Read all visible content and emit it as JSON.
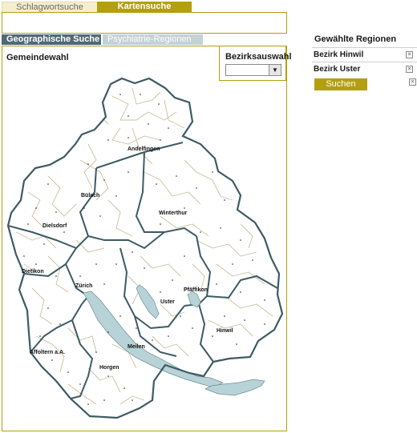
{
  "tabs_top": {
    "schlagwort": "Schlagwortsuche",
    "karten": "Kartensuche"
  },
  "tabs_sub": {
    "geo": "Geographische Suche",
    "psych": "Psychiatrie-Regionen"
  },
  "map": {
    "title": "Gemeindewahl",
    "districts": {
      "andelfingen": "Andelfingen",
      "buelach": "Bülach",
      "winterthur": "Winterthur",
      "dielsdorf": "Dielsdorf",
      "dietikon": "Dietikon",
      "zuerich": "Zürich",
      "pfaeffikon": "Pfäffikon",
      "uster": "Uster",
      "hinwil": "Hinwil",
      "affoltern": "Affoltern a.A.",
      "meilen": "Meilen",
      "horgen": "Horgen"
    },
    "colors": {
      "outline": "#3d5a63",
      "inner_border": "#c9c0a0",
      "lake": "#b7d3d7"
    }
  },
  "bezirk": {
    "label": "Bezirksauswahl",
    "selected": ""
  },
  "sidebar": {
    "title": "Gewählte Regionen",
    "items": [
      {
        "label": "Bezirk Hinwil"
      },
      {
        "label": "Bezirk Uster"
      }
    ],
    "search_label": "Suchen"
  },
  "icons": {
    "remove": "close-box-icon",
    "dropdown": "chevron-down-icon"
  },
  "accent_colors": {
    "gold": "#b39f10",
    "teal": "#4f6a73",
    "light_teal": "#c3d2d4"
  }
}
